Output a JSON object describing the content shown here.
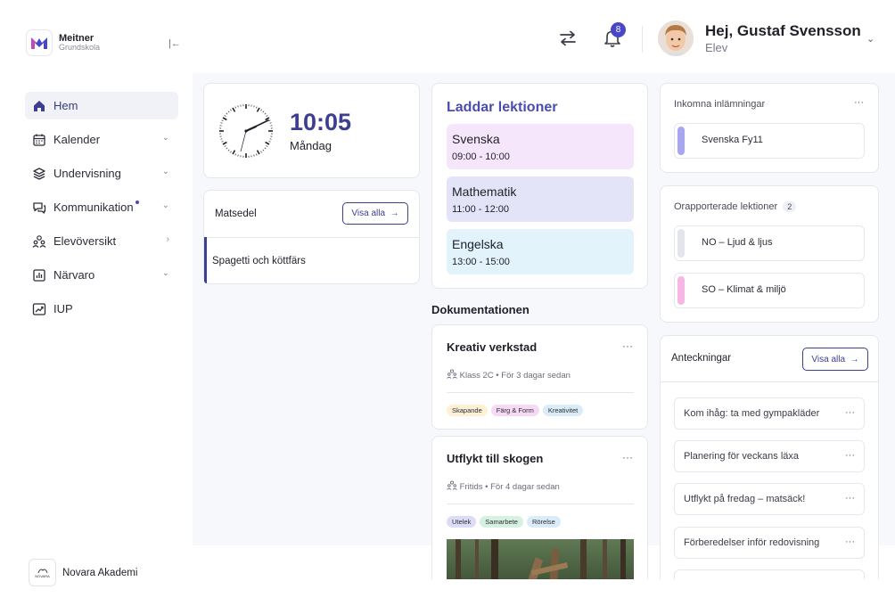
{
  "brand": {
    "name": "Meitner",
    "sub": "Grundskola",
    "collapse_icon": "sidebar-collapse-icon"
  },
  "nav": [
    {
      "label": "Hem",
      "icon": "home-icon",
      "active": true,
      "chevron": ""
    },
    {
      "label": "Kalender",
      "icon": "calendar-icon",
      "chevron": "⌄"
    },
    {
      "label": "Undervisning",
      "icon": "layers-icon",
      "chevron": "⌄"
    },
    {
      "label": "Kommunikation",
      "icon": "chat-icon",
      "chevron": "⌄",
      "dot": true
    },
    {
      "label": "Elevöversikt",
      "icon": "people-icon",
      "chevron": "›"
    },
    {
      "label": "Närvaro",
      "icon": "chart-icon",
      "chevron": "⌄"
    },
    {
      "label": "IUP",
      "icon": "trend-icon",
      "chevron": ""
    }
  ],
  "org": {
    "name": "Novara Akademi",
    "logo_text": "NOVARA"
  },
  "topbar": {
    "notifications": "8",
    "greeting": "Hej, Gustaf Svensson",
    "role": "Elev"
  },
  "clock": {
    "time": "10:05",
    "day": "Måndag"
  },
  "menu": {
    "title": "Matsedel",
    "button": "Visa alla",
    "item": "Spagetti och köttfärs"
  },
  "lessons": {
    "title": "Laddar lektioner",
    "items": [
      {
        "name": "Svenska",
        "time": "09:00 - 10:00",
        "color": "#f6e6fb"
      },
      {
        "name": "Mathematik",
        "time": "11:00 - 12:00",
        "color": "#e4e4f9"
      },
      {
        "name": "Engelska",
        "time": "13:00 - 15:00",
        "color": "#e3f3fb"
      }
    ]
  },
  "docs": {
    "heading": "Dokumentationen",
    "items": [
      {
        "title": "Kreativ verkstad",
        "group": "Klass 2C",
        "when": "För 3 dagar sedan",
        "tags": [
          {
            "label": "Skapande",
            "color": "#fdf0d3"
          },
          {
            "label": "Färg & Form",
            "color": "#f6d9f3"
          },
          {
            "label": "Kreativitet",
            "color": "#d9ecf8"
          }
        ]
      },
      {
        "title": "Utflykt till skogen",
        "group": "Fritids",
        "when": "För 4 dagar sedan",
        "tags": [
          {
            "label": "Utelek",
            "color": "#dcdcf6"
          },
          {
            "label": "Samarbete",
            "color": "#d6f1e1"
          },
          {
            "label": "Rörelse",
            "color": "#d9ecf8"
          }
        ]
      }
    ]
  },
  "submissions": {
    "title": "Inkomna inlämningar",
    "items": [
      {
        "label": "Svenska Fy11",
        "color": "#a9a6f0"
      }
    ]
  },
  "unreported": {
    "title": "Orapporterade lektioner",
    "count": "2",
    "items": [
      {
        "label": "NO – Ljud & ljus",
        "color": "#e4e5ec"
      },
      {
        "label": "SO – Klimat & miljö",
        "color": "#f6b8e3"
      }
    ]
  },
  "notes": {
    "title": "Anteckningar",
    "button": "Visa alla",
    "items": [
      "Kom ihåg: ta med gympakläder",
      "Planering för veckans läxa",
      "Utflykt på fredag – matsäck!",
      "Förberedelser inför redovisning"
    ]
  },
  "more_icon": "···"
}
